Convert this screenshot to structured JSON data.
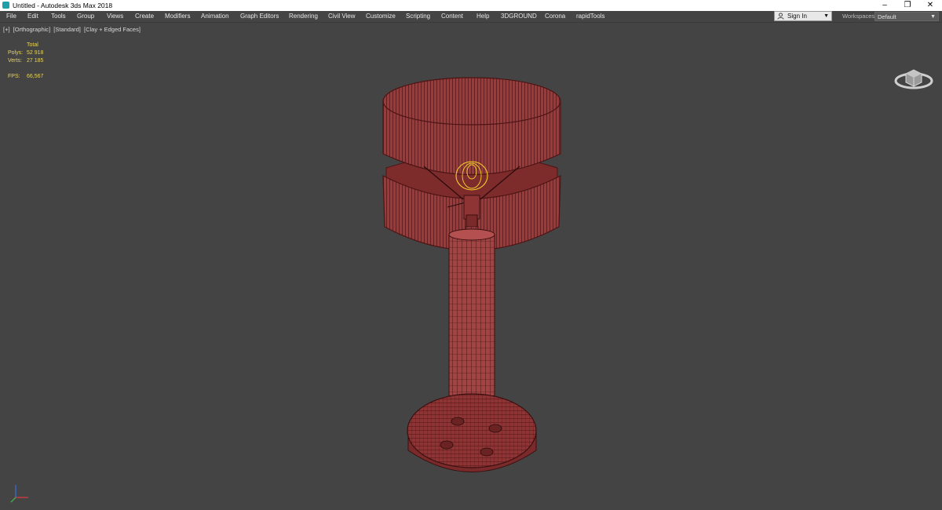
{
  "window": {
    "title": "Untitled - Autodesk 3ds Max 2018",
    "controls": {
      "minimize": "–",
      "maximize": "❐",
      "close": "✕"
    }
  },
  "menu": {
    "items": [
      "File",
      "Edit",
      "Tools",
      "Group",
      "Views",
      "Create",
      "Modifiers",
      "Animation",
      "Graph Editors",
      "Rendering",
      "Civil View",
      "Customize",
      "Scripting",
      "Content",
      "Help",
      "3DGROUND",
      "Corona",
      "rapidTools"
    ]
  },
  "account": {
    "sign_in": "Sign In",
    "dropdown": "▼"
  },
  "workspaces": {
    "label": "Workspaces:",
    "value": "Default",
    "dropdown": "▼"
  },
  "viewport": {
    "label_parts": [
      "[+]",
      "[Orthographic]",
      "[Standard]",
      "[Clay + Edged Faces]"
    ],
    "stats": {
      "header": "Total",
      "polys_label": "Polys:",
      "polys_value": "52 918",
      "verts_label": "Verts:",
      "verts_value": "27 185",
      "fps_label": "FPS:",
      "fps_value": "66,567"
    }
  },
  "colors": {
    "background": "#444444",
    "stats_text": "#e8d35a",
    "model_fill": "#9a3b3b",
    "model_wire": "#4d1414",
    "selection_gizmo": "#f2d22a"
  }
}
